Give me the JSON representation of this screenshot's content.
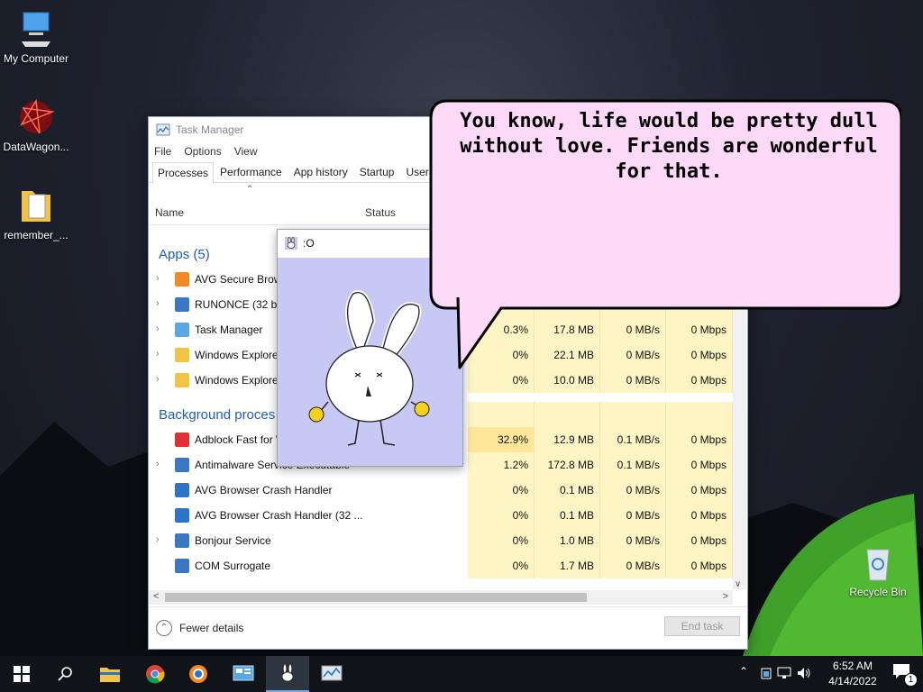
{
  "desktop": {
    "icons": [
      {
        "label": "My Computer"
      },
      {
        "label": "DataWagon..."
      },
      {
        "label": "remember_..."
      },
      {
        "label": "Recycle Bin"
      }
    ]
  },
  "task_manager": {
    "title": "Task Manager",
    "menu": [
      "File",
      "Options",
      "View"
    ],
    "tabs": [
      "Processes",
      "Performance",
      "App history",
      "Startup",
      "Users"
    ],
    "columns": {
      "name": "Name",
      "status": "Status"
    },
    "apps_header": "Apps (5)",
    "background_header": "Background proces",
    "rows": [
      {
        "name": "AVG Secure Brows",
        "expand": true,
        "icon": "avg-browser-icon",
        "cpu": "",
        "mem": "",
        "disk": "",
        "net": ""
      },
      {
        "name": "RUNONCE (32 bit",
        "expand": true,
        "icon": "window-app-icon",
        "cpu": "",
        "mem": "",
        "disk": "",
        "net": ""
      },
      {
        "name": "Task Manager",
        "expand": true,
        "icon": "task-manager-icon",
        "cpu": "0.3%",
        "mem": "17.8 MB",
        "disk": "0 MB/s",
        "net": "0 Mbps"
      },
      {
        "name": "Windows Explore",
        "expand": true,
        "icon": "folder-icon",
        "cpu": "0%",
        "mem": "22.1 MB",
        "disk": "0 MB/s",
        "net": "0 Mbps"
      },
      {
        "name": "Windows Explore",
        "expand": true,
        "icon": "folder-icon",
        "cpu": "0%",
        "mem": "10.0 MB",
        "disk": "0 MB/s",
        "net": "0 Mbps"
      },
      {
        "name": "Adblock Fast for W",
        "expand": false,
        "icon": "adblock-icon",
        "cpu": "32.9%",
        "mem": "12.9 MB",
        "disk": "0.1 MB/s",
        "net": "0 Mbps"
      },
      {
        "name": "Antimalware Service Executable",
        "expand": true,
        "icon": "window-app-icon",
        "cpu": "1.2%",
        "mem": "172.8 MB",
        "disk": "0.1 MB/s",
        "net": "0 Mbps"
      },
      {
        "name": "AVG Browser Crash Handler",
        "expand": false,
        "icon": "avg-crash-icon",
        "cpu": "0%",
        "mem": "0.1 MB",
        "disk": "0 MB/s",
        "net": "0 Mbps"
      },
      {
        "name": "AVG Browser Crash Handler (32 ...",
        "expand": false,
        "icon": "avg-crash-icon",
        "cpu": "0%",
        "mem": "0.1 MB",
        "disk": "0 MB/s",
        "net": "0 Mbps"
      },
      {
        "name": "Bonjour Service",
        "expand": true,
        "icon": "window-app-icon",
        "cpu": "0%",
        "mem": "1.0 MB",
        "disk": "0 MB/s",
        "net": "0 Mbps"
      },
      {
        "name": "COM Surrogate",
        "expand": false,
        "icon": "window-app-icon",
        "cpu": "0%",
        "mem": "1.7 MB",
        "disk": "0 MB/s",
        "net": "0 Mbps"
      }
    ],
    "fewer_details": "Fewer details",
    "end_task": "End task"
  },
  "bunny_window": {
    "title": ":O"
  },
  "speech_bubble": {
    "text": "You know, life would be pretty dull without love. Friends are wonderful for that."
  },
  "taskbar": {
    "buttons": [
      "start-icon",
      "search-icon",
      "file-explorer-icon",
      "chrome-icon",
      "avg-browser-icon",
      "control-panel-icon",
      "bunny-app-icon",
      "task-manager-icon"
    ],
    "time": "6:52 AM",
    "date": "4/14/2022",
    "notification_count": "1"
  }
}
